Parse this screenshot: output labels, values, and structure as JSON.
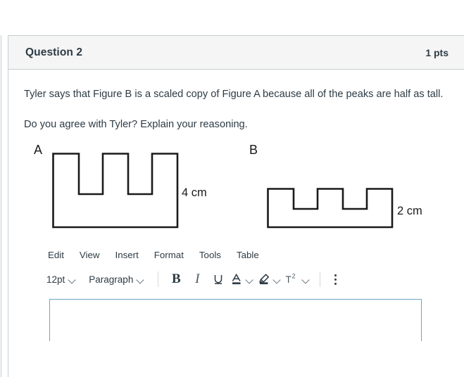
{
  "question": {
    "title": "Question 2",
    "points": "1 pts",
    "paragraph_1": "Tyler says that Figure B is a scaled copy of Figure A because all of the peaks are half as tall.",
    "paragraph_2": "Do you agree with Tyler? Explain your reasoning."
  },
  "figures": [
    {
      "label": "A",
      "dimension": "4 cm",
      "peaks": 3,
      "outline_color": "#1a1a1a"
    },
    {
      "label": "B",
      "dimension": "2 cm",
      "peaks": 3,
      "outline_color": "#1a1a1a"
    }
  ],
  "editor": {
    "menubar": [
      {
        "label": "Edit"
      },
      {
        "label": "View"
      },
      {
        "label": "Insert"
      },
      {
        "label": "Format"
      },
      {
        "label": "Tools"
      },
      {
        "label": "Table"
      }
    ],
    "toolbar": {
      "font_size": "12pt",
      "block_format": "Paragraph",
      "bold": "B",
      "italic": "I",
      "underline": "U",
      "text_color": "A",
      "highlight_color": "highlighter",
      "superscript": "T",
      "superscript_exponent": "2",
      "more_options": "more-options"
    },
    "textarea_value": "",
    "textarea_placeholder": "",
    "focus_border_color": "#6ca6c4"
  },
  "colors": {
    "header_bg": "#f5f5f5",
    "border": "#c7cdd1",
    "text": "#2d3b45"
  }
}
